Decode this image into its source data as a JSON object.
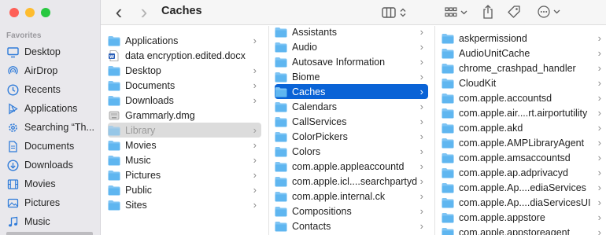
{
  "window": {
    "title": "Caches"
  },
  "sidebar": {
    "section": "Favorites",
    "items": [
      {
        "label": "Desktop",
        "icon": "desktop-icon"
      },
      {
        "label": "AirDrop",
        "icon": "airdrop-icon"
      },
      {
        "label": "Recents",
        "icon": "clock-icon"
      },
      {
        "label": "Applications",
        "icon": "applications-icon"
      },
      {
        "label": "Searching “Th...",
        "icon": "gear-icon"
      },
      {
        "label": "Documents",
        "icon": "document-icon"
      },
      {
        "label": "Downloads",
        "icon": "download-icon"
      },
      {
        "label": "Movies",
        "icon": "film-icon"
      },
      {
        "label": "Pictures",
        "icon": "photo-icon"
      },
      {
        "label": "Music",
        "icon": "music-icon"
      }
    ]
  },
  "columns": {
    "col1": [
      {
        "label": "Applications",
        "kind": "folder",
        "chevron": true
      },
      {
        "label": "data encryption.edited.docx",
        "kind": "docx",
        "chevron": false
      },
      {
        "label": "Desktop",
        "kind": "folder",
        "chevron": true
      },
      {
        "label": "Documents",
        "kind": "folder",
        "chevron": true
      },
      {
        "label": "Downloads",
        "kind": "folder",
        "chevron": true
      },
      {
        "label": "Grammarly.dmg",
        "kind": "dmg",
        "chevron": false
      },
      {
        "label": "Library",
        "kind": "folder",
        "chevron": true,
        "state": "dim"
      },
      {
        "label": "Movies",
        "kind": "folder",
        "chevron": true
      },
      {
        "label": "Music",
        "kind": "folder",
        "chevron": true
      },
      {
        "label": "Pictures",
        "kind": "folder",
        "chevron": true
      },
      {
        "label": "Public",
        "kind": "folder",
        "chevron": true
      },
      {
        "label": "Sites",
        "kind": "folder",
        "chevron": true
      }
    ],
    "col2": [
      {
        "label": "Assistants",
        "kind": "folder",
        "chevron": true
      },
      {
        "label": "Audio",
        "kind": "folder",
        "chevron": true
      },
      {
        "label": "Autosave Information",
        "kind": "folder",
        "chevron": true
      },
      {
        "label": "Biome",
        "kind": "folder",
        "chevron": true
      },
      {
        "label": "Caches",
        "kind": "folder",
        "chevron": true,
        "state": "sel"
      },
      {
        "label": "Calendars",
        "kind": "folder",
        "chevron": true
      },
      {
        "label": "CallServices",
        "kind": "folder",
        "chevron": true
      },
      {
        "label": "ColorPickers",
        "kind": "folder",
        "chevron": true
      },
      {
        "label": "Colors",
        "kind": "folder",
        "chevron": true
      },
      {
        "label": "com.apple.appleaccountd",
        "kind": "folder",
        "chevron": true
      },
      {
        "label": "com.apple.icl....searchpartyd",
        "kind": "folder",
        "chevron": true
      },
      {
        "label": "com.apple.internal.ck",
        "kind": "folder",
        "chevron": true
      },
      {
        "label": "Compositions",
        "kind": "folder",
        "chevron": true
      },
      {
        "label": "Contacts",
        "kind": "folder",
        "chevron": true
      }
    ],
    "col3": [
      {
        "label": "askpermissiond",
        "kind": "folder",
        "chevron": true
      },
      {
        "label": "AudioUnitCache",
        "kind": "folder",
        "chevron": true
      },
      {
        "label": "chrome_crashpad_handler",
        "kind": "folder",
        "chevron": true
      },
      {
        "label": "CloudKit",
        "kind": "folder",
        "chevron": true
      },
      {
        "label": "com.apple.accountsd",
        "kind": "folder",
        "chevron": true
      },
      {
        "label": "com.apple.air....rt.airportutility",
        "kind": "folder",
        "chevron": true
      },
      {
        "label": "com.apple.akd",
        "kind": "folder",
        "chevron": true
      },
      {
        "label": "com.apple.AMPLibraryAgent",
        "kind": "folder",
        "chevron": true
      },
      {
        "label": "com.apple.amsaccountsd",
        "kind": "folder",
        "chevron": true
      },
      {
        "label": "com.apple.ap.adprivacyd",
        "kind": "folder",
        "chevron": true
      },
      {
        "label": "com.apple.Ap....ediaServices",
        "kind": "folder",
        "chevron": true
      },
      {
        "label": "com.apple.Ap....diaServicesUI",
        "kind": "folder",
        "chevron": true
      },
      {
        "label": "com.apple.appstore",
        "kind": "folder",
        "chevron": true
      },
      {
        "label": "com.apple.appstoreagent",
        "kind": "folder",
        "chevron": true
      }
    ]
  },
  "colors": {
    "accent": "#0a63d6",
    "sidebar_icon": "#2f7bd9",
    "folder": "#5fb6f0"
  },
  "glyphs": {
    "chevron": "›",
    "back": "‹",
    "forward": "›"
  }
}
